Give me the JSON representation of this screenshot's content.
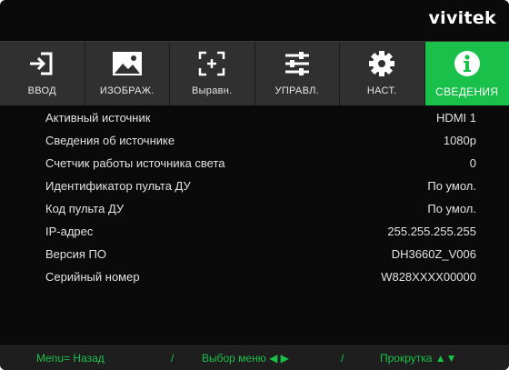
{
  "brand": {
    "logo_text": "vivitek"
  },
  "tabs": [
    {
      "label": "ВВОД",
      "icon": "input-icon",
      "active": false
    },
    {
      "label": "ИЗОБРАЖ.",
      "icon": "image-icon",
      "active": false
    },
    {
      "label": "Выравн.",
      "icon": "align-icon",
      "active": false
    },
    {
      "label": "УПРАВЛ.",
      "icon": "sliders-icon",
      "active": false
    },
    {
      "label": "НАСТ.",
      "icon": "gear-icon",
      "active": false
    },
    {
      "label": "СВЕДЕНИЯ",
      "icon": "info-icon",
      "active": true
    }
  ],
  "info": [
    {
      "label": "Активный источник",
      "value": "HDMI 1"
    },
    {
      "label": "Сведения об источнике",
      "value": "1080p"
    },
    {
      "label": "Счетчик работы источника света",
      "value": "0"
    },
    {
      "label": "Идентификатор пульта ДУ",
      "value": "По умол."
    },
    {
      "label": "Код пульта ДУ",
      "value": "По умол."
    },
    {
      "label": "IP-адрес",
      "value": "255.255.255.255"
    },
    {
      "label": "Версия ПО",
      "value": "DH3660Z_V006"
    },
    {
      "label": "Серийный номер",
      "value": "W828XXXX00000"
    }
  ],
  "footer": {
    "back": "Menu= Назад",
    "sep1": "/",
    "select": "Выбор меню",
    "select_arrows": "◀ ▶",
    "sep2": "/",
    "scroll": "Прокрутка",
    "scroll_arrows": "▲▼"
  },
  "colors": {
    "accent": "#19c14a",
    "tab_bg": "#303030",
    "background": "#0a0a0a"
  }
}
